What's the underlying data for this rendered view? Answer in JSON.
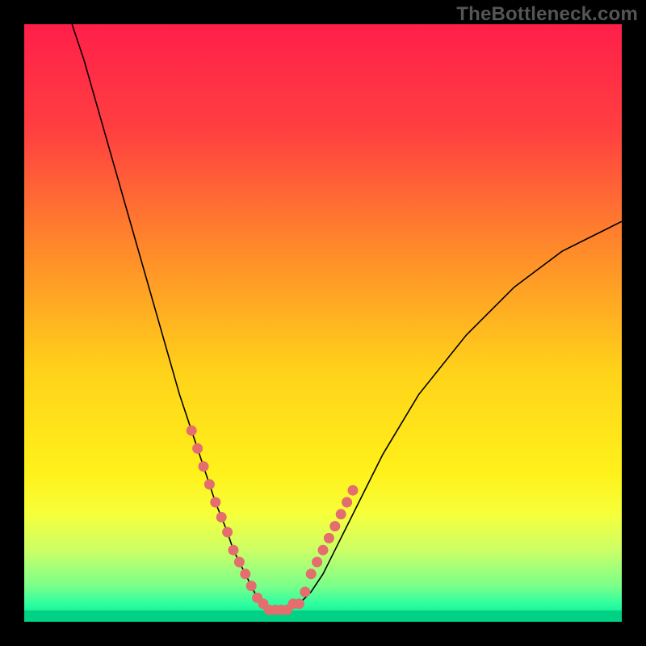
{
  "watermark": "TheBottleneck.com",
  "colors": {
    "background": "#000000",
    "curve": "#000000",
    "dot": "#e46d6d",
    "gradient_stops": [
      {
        "offset": 0.0,
        "color": "#ff1f4a"
      },
      {
        "offset": 0.18,
        "color": "#ff4040"
      },
      {
        "offset": 0.38,
        "color": "#ff8b2a"
      },
      {
        "offset": 0.58,
        "color": "#ffd21a"
      },
      {
        "offset": 0.75,
        "color": "#fff11a"
      },
      {
        "offset": 0.82,
        "color": "#f6ff3a"
      },
      {
        "offset": 0.88,
        "color": "#ccff66"
      },
      {
        "offset": 0.94,
        "color": "#7aff8a"
      },
      {
        "offset": 0.97,
        "color": "#2effa0"
      },
      {
        "offset": 1.0,
        "color": "#00e38c"
      }
    ],
    "bottom_band": "#00d185"
  },
  "chart_data": {
    "type": "line",
    "title": "",
    "xlabel": "",
    "ylabel": "",
    "xlim": [
      0,
      100
    ],
    "ylim": [
      0,
      100
    ],
    "x": [
      8,
      10,
      12,
      14,
      16,
      18,
      20,
      22,
      24,
      26,
      28,
      30,
      32,
      34,
      35,
      36,
      37,
      38,
      39,
      40,
      41,
      42,
      44,
      46,
      48,
      50,
      52,
      54,
      56,
      58,
      60,
      63,
      66,
      70,
      74,
      78,
      82,
      86,
      90,
      94,
      98,
      100
    ],
    "values": [
      100,
      94,
      87,
      80,
      73,
      66,
      59,
      52,
      45,
      38,
      32,
      26,
      20,
      15,
      12,
      10,
      8,
      6,
      4,
      3,
      2,
      2,
      2,
      3,
      5,
      8,
      12,
      16,
      20,
      24,
      28,
      33,
      38,
      43,
      48,
      52,
      56,
      59,
      62,
      64,
      66,
      67
    ],
    "highlight_points_x": [
      28,
      29,
      30,
      31,
      32,
      33,
      34,
      35,
      36,
      37,
      38,
      39,
      40,
      41,
      42,
      43,
      44,
      45,
      46,
      47,
      48,
      49,
      50,
      51,
      52,
      53,
      54,
      55
    ],
    "highlight_points_y": [
      32,
      29,
      26,
      23,
      20,
      17.5,
      15,
      12,
      10,
      8,
      6,
      4,
      3,
      2,
      2,
      2,
      2,
      3,
      3,
      5,
      8,
      10,
      12,
      14,
      16,
      18,
      20,
      22
    ]
  }
}
